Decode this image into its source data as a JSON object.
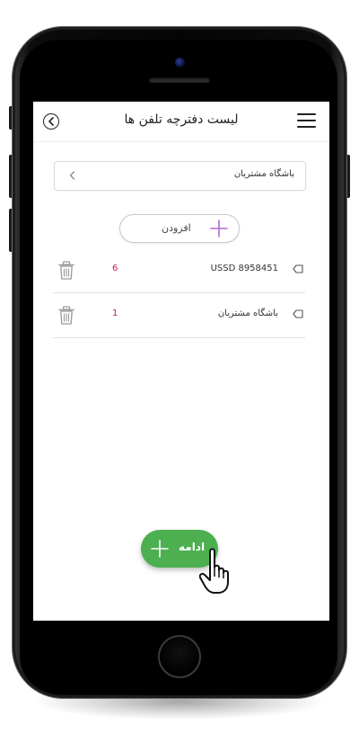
{
  "header": {
    "title": "لیست دفترچه تلفن ها"
  },
  "dropdown": {
    "selected": "باشگاه مشتریان"
  },
  "add_button": {
    "label": "افزودن"
  },
  "list": {
    "items": [
      {
        "label": "USSD 8958451",
        "count": "6"
      },
      {
        "label": "باشگاه مشتریان",
        "count": "1"
      }
    ]
  },
  "continue_button": {
    "label": "ادامه"
  },
  "colors": {
    "accent_green": "#4caf50",
    "add_icon_purple": "#b36ad6",
    "count_red": "#c2185b"
  },
  "icons": {
    "back": "back-circle-icon",
    "menu": "hamburger-menu-icon",
    "chevron": "chevron-left-icon",
    "add": "plus-icon",
    "delete": "trash-icon",
    "item": "tag-icon",
    "pointer": "hand-pointer-icon"
  }
}
